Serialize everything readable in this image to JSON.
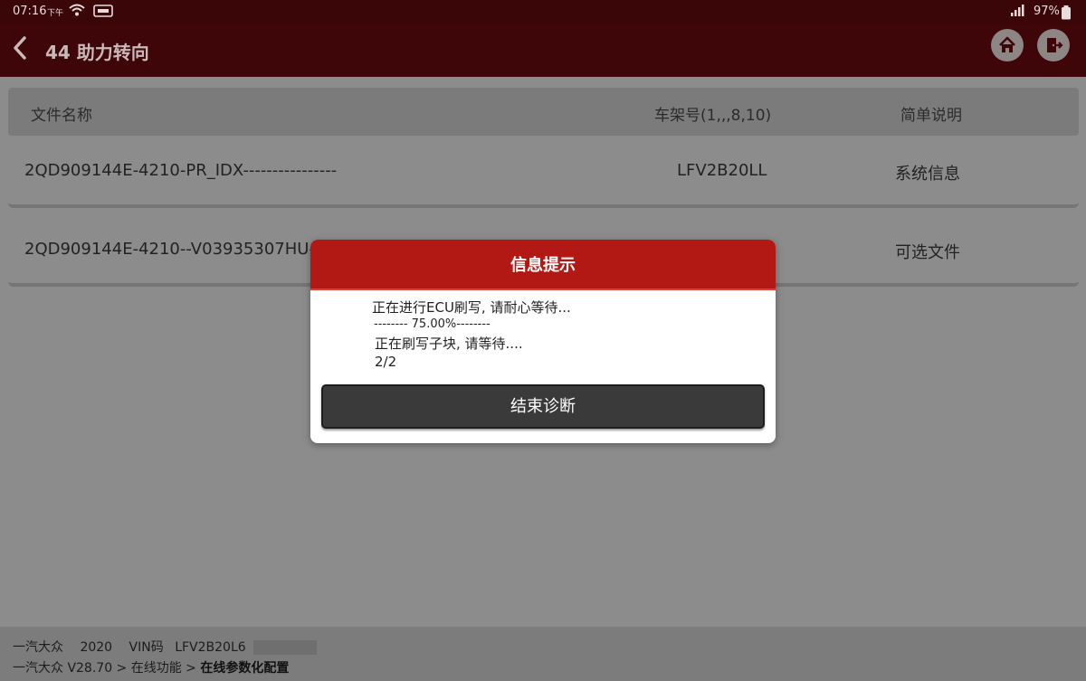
{
  "status_bar": {
    "time": "07:16",
    "ampm": "下午",
    "battery": "97%"
  },
  "header": {
    "title": "44 助力转向",
    "icons": [
      "back-icon",
      "home-icon",
      "exit-icon"
    ]
  },
  "table": {
    "columns": [
      "文件名称",
      "车架号(1,,,8,10)",
      "简单说明"
    ],
    "rows": [
      {
        "file": "2QD909144E-4210-PR_IDX----------------",
        "vin": "LFV2B20LL",
        "desc": "系统信息"
      },
      {
        "file": "2QD909144E-4210--V03935307HU-",
        "vin": "",
        "desc": "可选文件"
      }
    ]
  },
  "dialog": {
    "title": "信息提示",
    "lines": [
      "正在进行ECU刷写, 请耐心等待...",
      "-------- 75.00%--------",
      "正在刷写子块, 请等待....",
      "2/2"
    ],
    "button": "结束诊断"
  },
  "footer": {
    "brand": "一汽大众",
    "year": "2020",
    "vin_label": "VIN码",
    "vin": "LFV2B20L6",
    "breadcrumb_prefix": "一汽大众 V28.70 > 在线功能 >",
    "breadcrumb_current": "在线参数化配置"
  },
  "colors": {
    "header_bg": "#3f0609",
    "dialog_title_bg": "#b31914",
    "button_bg": "#3a3a3a"
  }
}
